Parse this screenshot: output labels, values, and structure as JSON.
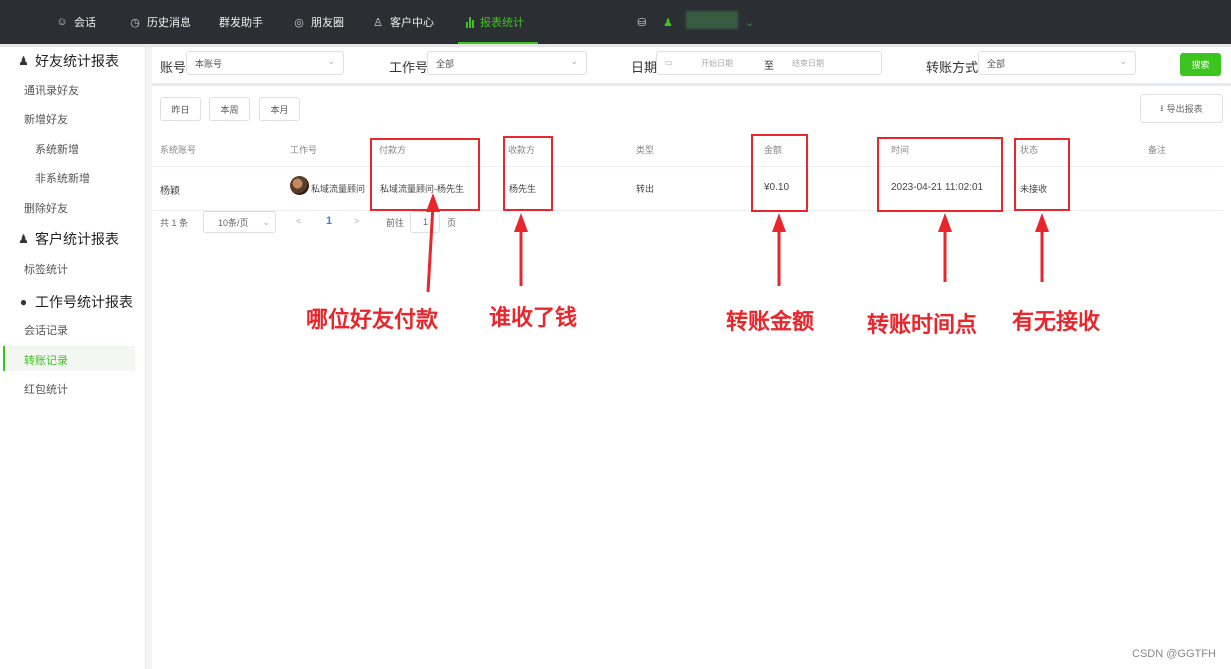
{
  "topnav": {
    "items": [
      {
        "label": "会话",
        "icon": "chat-icon"
      },
      {
        "label": "历史消息",
        "icon": "clock-icon"
      },
      {
        "label": "群发助手",
        "icon": ""
      },
      {
        "label": "朋友圈",
        "icon": "moments-icon"
      },
      {
        "label": "客户中心",
        "icon": "user-icon"
      },
      {
        "label": "报表统计",
        "icon": "bar-chart-icon",
        "active": true
      }
    ],
    "accent": "#3cc51f"
  },
  "sidebar": {
    "sections": [
      {
        "title": "好友统计报表",
        "icon": "user-icon"
      },
      {
        "title": "客户统计报表",
        "icon": "user-icon"
      },
      {
        "title": "工作号统计报表",
        "icon": "wechat-icon"
      }
    ],
    "items": {
      "contacts": "通讯录好友",
      "new_friends": "新增好友",
      "system_new": "系统新增",
      "non_system_new": "非系统新增",
      "deleted": "删除好友",
      "tags": "标签统计",
      "chat_records": "会话记录",
      "transfer_records": "转账记录",
      "red_packet": "红包统计"
    }
  },
  "filters": {
    "account_label": "账号",
    "account_value": "本账号",
    "worker_label": "工作号",
    "worker_value": "全部",
    "date_label": "日期",
    "date_start_placeholder": "开始日期",
    "date_sep": "至",
    "date_end_placeholder": "结束日期",
    "transfer_label": "转账方式",
    "transfer_value": "全部",
    "search_button": "搜索"
  },
  "quick": {
    "yesterday": "昨日",
    "this_week": "本周",
    "this_month": "本月",
    "export": "导出报表"
  },
  "table": {
    "headers": [
      "系统账号",
      "工作号",
      "付款方",
      "收款方",
      "类型",
      "金额",
      "时间",
      "状态",
      "备注"
    ],
    "rows": [
      {
        "system_account": "杨颖",
        "worker": "私域流量顾问",
        "payer": "私域流量顾问-杨先生",
        "payee": "杨先生",
        "type": "转出",
        "amount": "¥0.10",
        "time": "2023-04-21 11:02:01",
        "status": "未接收",
        "note": ""
      }
    ]
  },
  "pagination": {
    "total": "共 1 条",
    "page_size": "10条/页",
    "prev": "<",
    "current": "1",
    "next": ">",
    "goto": "前往",
    "goto_value": "1",
    "page_suffix": "页"
  },
  "annotations": {
    "payer": "哪位好友付款",
    "payee": "谁收了钱",
    "amount": "转账金额",
    "time": "转账时间点",
    "status": "有无接收",
    "color": "#e8262b"
  },
  "watermark": "CSDN @GGTFH"
}
